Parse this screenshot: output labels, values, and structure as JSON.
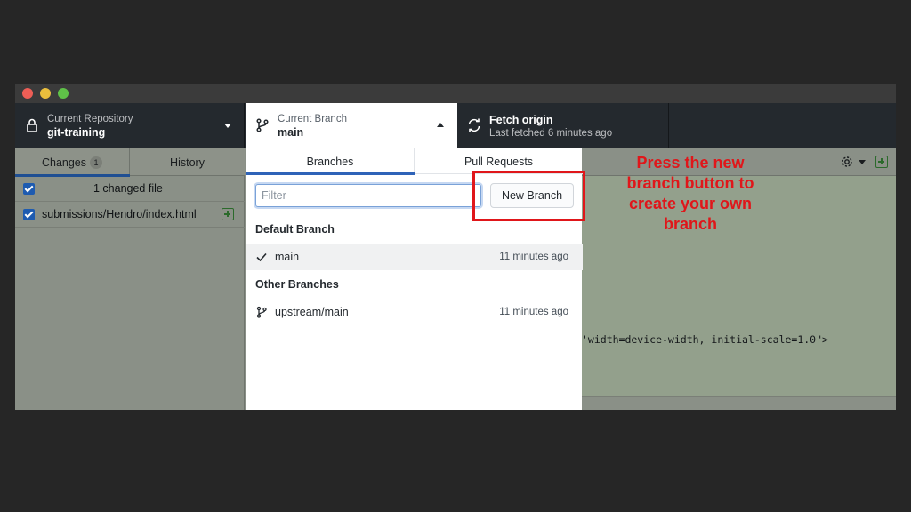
{
  "toolbar": {
    "repo_label": "Current Repository",
    "repo_value": "git-training",
    "branch_label": "Current Branch",
    "branch_value": "main",
    "fetch_title": "Fetch origin",
    "fetch_sub": "Last fetched 6 minutes ago"
  },
  "sidebar": {
    "tabs": [
      {
        "label": "Changes",
        "badge": "1"
      },
      {
        "label": "History"
      }
    ],
    "summary": "1 changed file",
    "files": [
      {
        "path": "submissions/Hendro/index.html"
      }
    ]
  },
  "dropdown": {
    "tabs": [
      {
        "label": "Branches"
      },
      {
        "label": "Pull Requests"
      }
    ],
    "filter_placeholder": "Filter",
    "new_branch_label": "New Branch",
    "default_header": "Default Branch",
    "other_header": "Other Branches",
    "branches": [
      {
        "name": "main",
        "time": "11 minutes ago"
      },
      {
        "name": "upstream/main",
        "time": "11 minutes ago"
      }
    ]
  },
  "diff": {
    "code_line": "'width=device-width, initial-scale=1.0\">"
  },
  "annotation": {
    "text": "Press the new branch button to create your own branch"
  },
  "colors": {
    "annotation": "#e0161a",
    "accent": "#2f63b8",
    "toolbar_bg": "#24292e"
  }
}
